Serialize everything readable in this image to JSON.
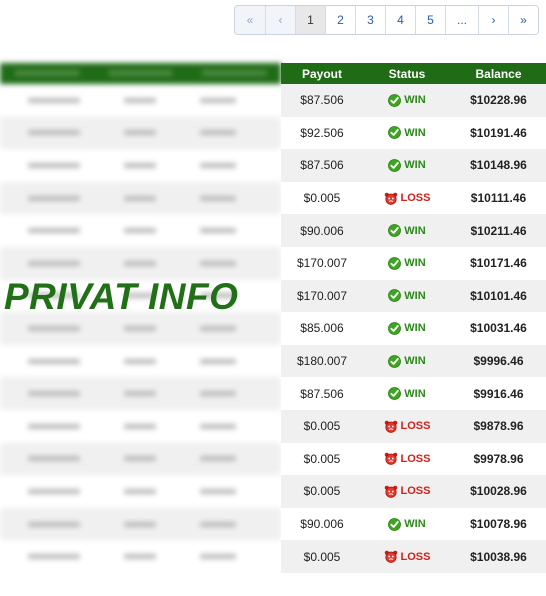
{
  "pagination": [
    {
      "label": "«",
      "state": "disabled"
    },
    {
      "label": "‹",
      "state": "disabled"
    },
    {
      "label": "1",
      "state": "active"
    },
    {
      "label": "2",
      "state": "normal"
    },
    {
      "label": "3",
      "state": "normal"
    },
    {
      "label": "4",
      "state": "normal"
    },
    {
      "label": "5",
      "state": "normal"
    },
    {
      "label": "...",
      "state": "normal"
    },
    {
      "label": "›",
      "state": "normal"
    },
    {
      "label": "»",
      "state": "normal"
    }
  ],
  "table": {
    "headers": {
      "payout": "Payout",
      "status": "Status",
      "balance": "Balance"
    },
    "rows": [
      {
        "payout": "$87.506",
        "status": "WIN",
        "balance": "$10228.96"
      },
      {
        "payout": "$92.506",
        "status": "WIN",
        "balance": "$10191.46"
      },
      {
        "payout": "$87.506",
        "status": "WIN",
        "balance": "$10148.96"
      },
      {
        "payout": "$0.005",
        "status": "LOSS",
        "balance": "$10111.46"
      },
      {
        "payout": "$90.006",
        "status": "WIN",
        "balance": "$10211.46"
      },
      {
        "payout": "$170.007",
        "status": "WIN",
        "balance": "$10171.46"
      },
      {
        "payout": "$170.007",
        "status": "WIN",
        "balance": "$10101.46"
      },
      {
        "payout": "$85.006",
        "status": "WIN",
        "balance": "$10031.46"
      },
      {
        "payout": "$180.007",
        "status": "WIN",
        "balance": "$9996.46"
      },
      {
        "payout": "$87.506",
        "status": "WIN",
        "balance": "$9916.46"
      },
      {
        "payout": "$0.005",
        "status": "LOSS",
        "balance": "$9878.96"
      },
      {
        "payout": "$0.005",
        "status": "LOSS",
        "balance": "$9978.96"
      },
      {
        "payout": "$0.005",
        "status": "LOSS",
        "balance": "$10028.96"
      },
      {
        "payout": "$90.006",
        "status": "WIN",
        "balance": "$10078.96"
      },
      {
        "payout": "$0.005",
        "status": "LOSS",
        "balance": "$10038.96"
      }
    ]
  },
  "watermark": "PRIVAT INFO",
  "colors": {
    "header_green": "#1f6b16",
    "win": "#2b8a1a",
    "loss": "#d3201b",
    "link": "#2a5cb0"
  },
  "icons": {
    "win": "green-check-icon",
    "loss": "red-alarm-icon"
  }
}
